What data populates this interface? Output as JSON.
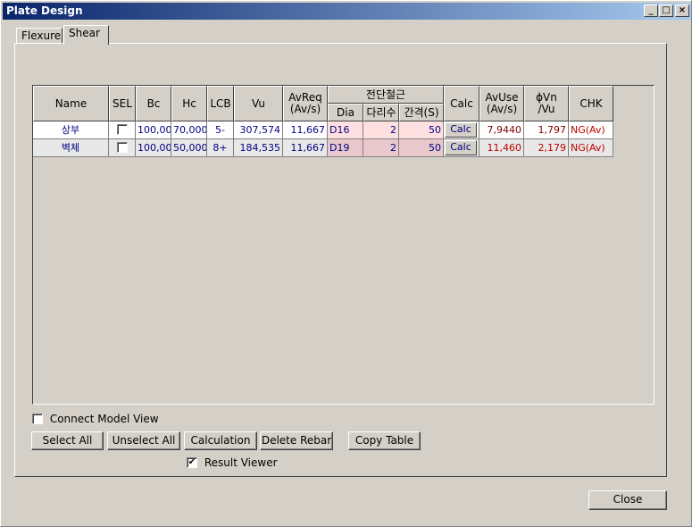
{
  "window": {
    "title": "Plate Design",
    "minimize_symbol": "_",
    "maximize_symbol": "□",
    "close_symbol": "×"
  },
  "tabs": [
    {
      "label": "Flexure",
      "active": false
    },
    {
      "label": "Shear",
      "active": true
    }
  ],
  "table": {
    "headers": {
      "name": "Name",
      "sel": "SEL",
      "bc": "Bc",
      "hc": "Hc",
      "lcb": "LCB",
      "vu": "Vu",
      "avreq_line1": "AvReq",
      "avreq_line2": "(Av/s)",
      "shear_group": "전단철근",
      "dia": "Dia",
      "legs": "다리수",
      "spacing": "간격(S)",
      "calc": "Calc",
      "avuse_line1": "AvUse",
      "avuse_line2": "(Av/s)",
      "phivn_line1": "ϕVn",
      "phivn_line2": "/Vu",
      "chk": "CHK"
    },
    "rows": [
      {
        "name": "상부",
        "sel": false,
        "bc": "100,00",
        "hc": "70,000",
        "lcb": "5-",
        "vu": "307,574",
        "avreq": "11,667",
        "dia": "D16",
        "legs": "2",
        "spacing": "50",
        "calc_label": "Calc",
        "avuse": "7,9440",
        "phivn": "1,797",
        "chk": "NG(Av)"
      },
      {
        "name": "벽체",
        "sel": false,
        "bc": "100,00",
        "hc": "50,000",
        "lcb": "8+",
        "vu": "184,535",
        "avreq": "11,667",
        "dia": "D19",
        "legs": "2",
        "spacing": "50",
        "calc_label": "Calc",
        "avuse": "11,460",
        "phivn": "2,179",
        "chk": "NG(Av)"
      }
    ]
  },
  "options": {
    "connect_model_view": {
      "label": "Connect Model View",
      "checked": false
    },
    "result_viewer": {
      "label": "Result Viewer",
      "checked": true,
      "check_mark": "✔"
    }
  },
  "buttons": {
    "select_all": "Select All",
    "unselect_all": "Unselect All",
    "calculation": "Calculation",
    "delete_rebar": "Delete Rebar",
    "copy_table": "Copy Table",
    "close": "Close"
  },
  "colors": {
    "title_bar": "#0a246a",
    "value_text": "#000080",
    "result_text": "#800000",
    "rebar_cell": "#ffe0e0",
    "rebar_cell_alt": "#e8c8cc"
  }
}
